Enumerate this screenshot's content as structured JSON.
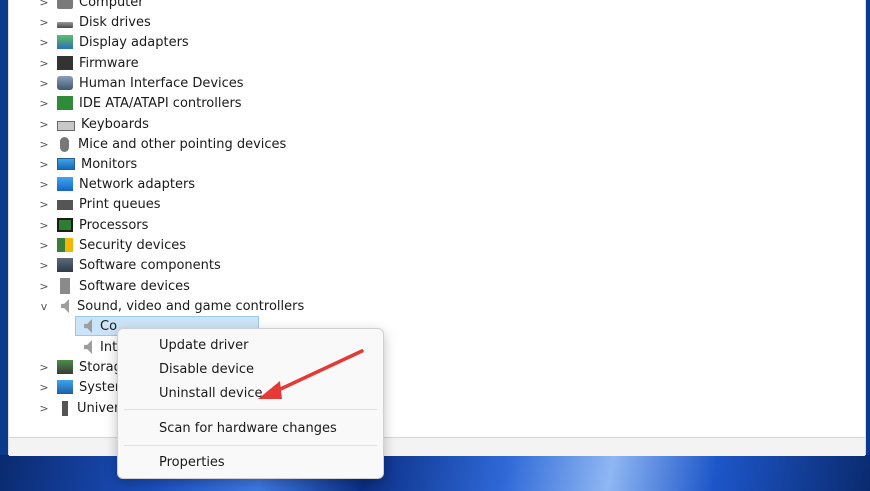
{
  "tree": {
    "items": [
      {
        "label": "Computer",
        "icon": "computer-icon",
        "expanded": false
      },
      {
        "label": "Disk drives",
        "icon": "disk-drive-icon",
        "expanded": false
      },
      {
        "label": "Display adapters",
        "icon": "display-adapter-icon",
        "expanded": false
      },
      {
        "label": "Firmware",
        "icon": "firmware-icon",
        "expanded": false
      },
      {
        "label": "Human Interface Devices",
        "icon": "hid-icon",
        "expanded": false
      },
      {
        "label": "IDE ATA/ATAPI controllers",
        "icon": "ide-controller-icon",
        "expanded": false
      },
      {
        "label": "Keyboards",
        "icon": "keyboard-icon",
        "expanded": false
      },
      {
        "label": "Mice and other pointing devices",
        "icon": "mouse-icon",
        "expanded": false
      },
      {
        "label": "Monitors",
        "icon": "monitor-icon",
        "expanded": false
      },
      {
        "label": "Network adapters",
        "icon": "network-adapter-icon",
        "expanded": false
      },
      {
        "label": "Print queues",
        "icon": "printer-icon",
        "expanded": false
      },
      {
        "label": "Processors",
        "icon": "processor-icon",
        "expanded": false
      },
      {
        "label": "Security devices",
        "icon": "security-device-icon",
        "expanded": false
      },
      {
        "label": "Software components",
        "icon": "software-component-icon",
        "expanded": false
      },
      {
        "label": "Software devices",
        "icon": "software-device-icon",
        "expanded": false
      },
      {
        "label": "Sound, video and game controllers",
        "icon": "speaker-icon",
        "expanded": true
      }
    ],
    "children": [
      {
        "label": "Co",
        "icon": "speaker-icon",
        "selected": true
      },
      {
        "label": "Int",
        "icon": "speaker-icon",
        "selected": false
      }
    ],
    "after": [
      {
        "label": "Storag",
        "icon": "storage-icon"
      },
      {
        "label": "System",
        "icon": "system-device-icon"
      },
      {
        "label": "Univer",
        "icon": "usb-icon"
      }
    ],
    "chevron_collapsed": ">",
    "chevron_expanded": "v"
  },
  "context_menu": {
    "items": [
      "Update driver",
      "Disable device",
      "Uninstall device",
      "Scan for hardware changes",
      "Properties"
    ]
  },
  "annotation": {
    "arrow_color": "#e53935"
  }
}
